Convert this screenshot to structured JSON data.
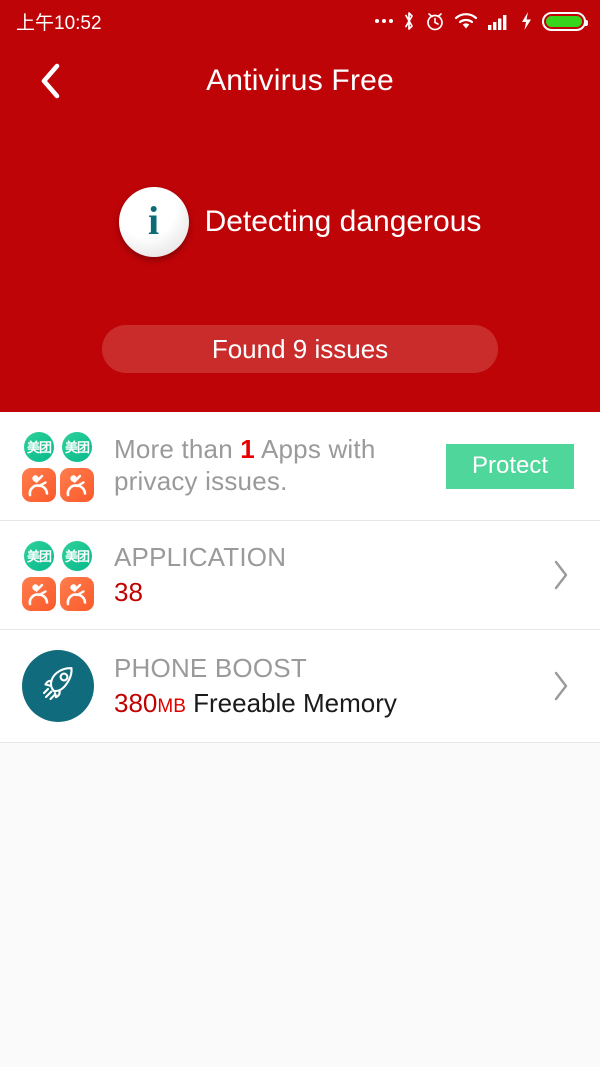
{
  "status_bar": {
    "time": "上午10:52",
    "icons": [
      "more-dots-icon",
      "bluetooth-icon",
      "alarm-icon",
      "wifi-icon",
      "signal-icon",
      "charging-bolt-icon",
      "battery-icon"
    ],
    "battery_color": "#37d51b"
  },
  "header": {
    "background_color": "#bf0408",
    "back_label": "‹",
    "title": "Antivirus Free",
    "detect_text": "Detecting dangerous",
    "info_glyph": "i",
    "found_button": "Found 9 issues",
    "found_button_color": "#ca2c2c"
  },
  "list": {
    "rows": [
      {
        "name": "privacy-issues",
        "icon": "app-icon-grid",
        "title_prefix": "More than ",
        "count": "1",
        "title_suffix": " Apps with",
        "line2": "privacy issues.",
        "action": "Protect",
        "action_color": "#4fd69b"
      },
      {
        "name": "application",
        "icon": "app-icon-grid",
        "title": "APPLICATION",
        "value": "38",
        "chevron": "›"
      },
      {
        "name": "phone-boost",
        "icon": "rocket-icon",
        "icon_color": "#106b7c",
        "title": "PHONE BOOST",
        "value": "380",
        "unit": "MB",
        "value_label": "Freeable Memory",
        "chevron": "›"
      }
    ],
    "app_icon_label": "美团"
  }
}
